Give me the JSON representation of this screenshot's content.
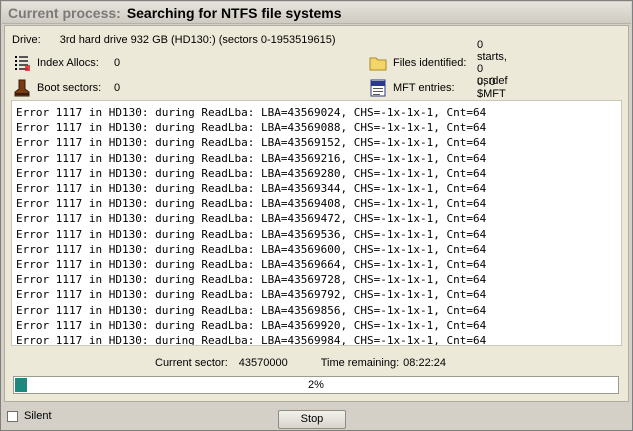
{
  "title": {
    "label": "Current process:",
    "text": "Searching for NTFS file systems"
  },
  "drive": {
    "label": "Drive:",
    "value": "3rd hard drive 932 GB (HD130:) (sectors 0-1953519615)"
  },
  "stats": {
    "index_allocs": {
      "label": "Index Allocs:",
      "value": "0",
      "icon": "index-icon"
    },
    "boot_sectors": {
      "label": "Boot sectors:",
      "value": "0",
      "icon": "boot-icon"
    },
    "files_identified": {
      "label": "Files identified:",
      "value": "0 starts, 0 usrdef",
      "icon": "folder-icon"
    },
    "mft_entries": {
      "label": "MFT entries:",
      "value": "0, 0 $MFT",
      "icon": "file-icon"
    }
  },
  "log_lines": [
    "Error 1117 in HD130: during ReadLba: LBA=43569024, CHS=-1x-1x-1, Cnt=64",
    "Error 1117 in HD130: during ReadLba: LBA=43569088, CHS=-1x-1x-1, Cnt=64",
    "Error 1117 in HD130: during ReadLba: LBA=43569152, CHS=-1x-1x-1, Cnt=64",
    "Error 1117 in HD130: during ReadLba: LBA=43569216, CHS=-1x-1x-1, Cnt=64",
    "Error 1117 in HD130: during ReadLba: LBA=43569280, CHS=-1x-1x-1, Cnt=64",
    "Error 1117 in HD130: during ReadLba: LBA=43569344, CHS=-1x-1x-1, Cnt=64",
    "Error 1117 in HD130: during ReadLba: LBA=43569408, CHS=-1x-1x-1, Cnt=64",
    "Error 1117 in HD130: during ReadLba: LBA=43569472, CHS=-1x-1x-1, Cnt=64",
    "Error 1117 in HD130: during ReadLba: LBA=43569536, CHS=-1x-1x-1, Cnt=64",
    "Error 1117 in HD130: during ReadLba: LBA=43569600, CHS=-1x-1x-1, Cnt=64",
    "Error 1117 in HD130: during ReadLba: LBA=43569664, CHS=-1x-1x-1, Cnt=64",
    "Error 1117 in HD130: during ReadLba: LBA=43569728, CHS=-1x-1x-1, Cnt=64",
    "Error 1117 in HD130: during ReadLba: LBA=43569792, CHS=-1x-1x-1, Cnt=64",
    "Error 1117 in HD130: during ReadLba: LBA=43569856, CHS=-1x-1x-1, Cnt=64",
    "Error 1117 in HD130: during ReadLba: LBA=43569920, CHS=-1x-1x-1, Cnt=64",
    "Error 1117 in HD130: during ReadLba: LBA=43569984, CHS=-1x-1x-1, Cnt=64"
  ],
  "status": {
    "current_sector_label": "Current sector:",
    "current_sector_value": "43570000",
    "time_remaining_label": "Time remaining:",
    "time_remaining_value": "08:22:24"
  },
  "progress": {
    "percent": 2,
    "text": "2%",
    "color": "#1b8a7e"
  },
  "footer": {
    "silent_label": "Silent",
    "silent_checked": false,
    "stop_label": "Stop"
  }
}
